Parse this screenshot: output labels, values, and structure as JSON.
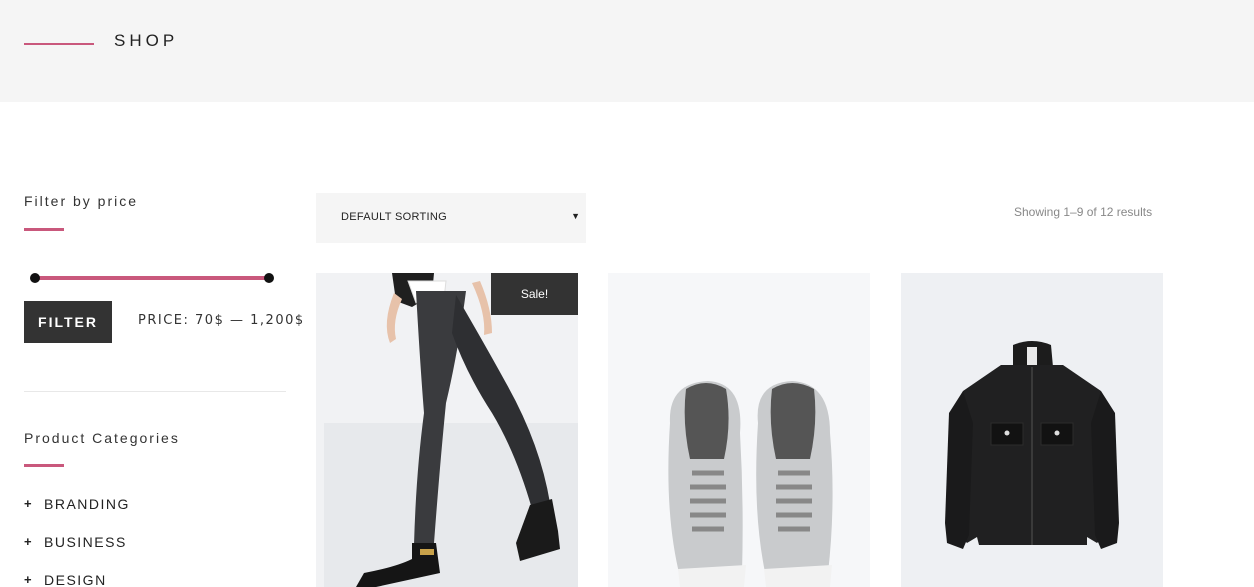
{
  "header": {
    "title": "SHOP"
  },
  "filter": {
    "title": "Filter by price",
    "button_label": "FILTER",
    "price_prefix": "PRICE:",
    "price_min": "70$",
    "price_sep": "—",
    "price_max": "1,200$"
  },
  "categories": {
    "title": "Product Categories",
    "items": [
      {
        "label": "BRANDING"
      },
      {
        "label": "BUSINESS"
      },
      {
        "label": "DESIGN"
      }
    ]
  },
  "toolbar": {
    "sorting_value": "DEFAULT SORTING",
    "results_text": "Showing 1–9 of 12 results"
  },
  "products": [
    {
      "badge": "Sale!",
      "image": "jeans-boots-image"
    },
    {
      "image": "sneakers-image"
    },
    {
      "image": "black-jacket-image"
    }
  ],
  "colors": {
    "accent": "#c9587c",
    "dark": "#333333",
    "hero_bg": "#f5f5f5"
  }
}
